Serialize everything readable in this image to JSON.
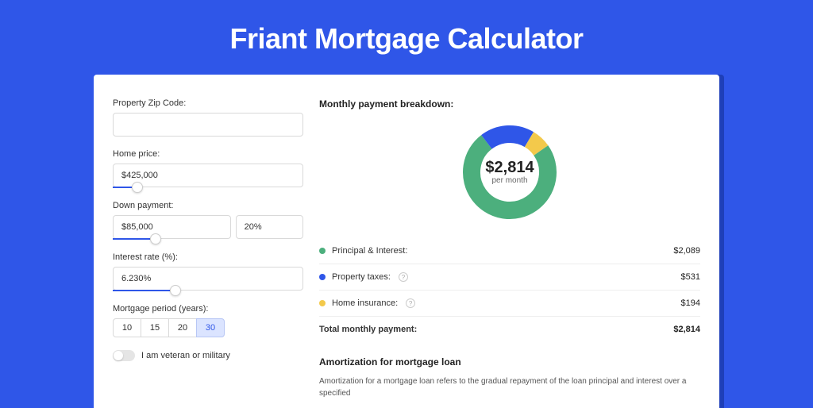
{
  "title": "Friant Mortgage Calculator",
  "form": {
    "zip": {
      "label": "Property Zip Code:",
      "value": ""
    },
    "home_price": {
      "label": "Home price:",
      "value": "$425,000",
      "slider_pct": 10
    },
    "down_payment": {
      "label": "Down payment:",
      "value": "$85,000",
      "pct_value": "20%",
      "slider_pct": 20
    },
    "interest_rate": {
      "label": "Interest rate (%):",
      "value": "6.230%",
      "slider_pct": 30
    },
    "period": {
      "label": "Mortgage period (years):",
      "options": [
        "10",
        "15",
        "20",
        "30"
      ],
      "selected": "30"
    },
    "veteran": {
      "label": "I am veteran or military",
      "checked": false
    }
  },
  "breakdown": {
    "title": "Monthly payment breakdown:",
    "total_amount": "$2,814",
    "per_month": "per month",
    "items": [
      {
        "label": "Principal & Interest:",
        "value": "$2,089",
        "color": "#4caf7d",
        "help": false
      },
      {
        "label": "Property taxes:",
        "value": "$531",
        "color": "#2f56e8",
        "help": true
      },
      {
        "label": "Home insurance:",
        "value": "$194",
        "color": "#f3c94b",
        "help": true
      }
    ],
    "total_row": {
      "label": "Total monthly payment:",
      "value": "$2,814"
    }
  },
  "amortization": {
    "title": "Amortization for mortgage loan",
    "text": "Amortization for a mortgage loan refers to the gradual repayment of the loan principal and interest over a specified"
  },
  "chart_data": {
    "type": "pie",
    "title": "Monthly payment breakdown",
    "categories": [
      "Principal & Interest",
      "Property taxes",
      "Home insurance"
    ],
    "values": [
      2089,
      531,
      194
    ],
    "colors": [
      "#4caf7d",
      "#2f56e8",
      "#f3c94b"
    ],
    "total": 2814,
    "center_label": "$2,814 per month"
  }
}
